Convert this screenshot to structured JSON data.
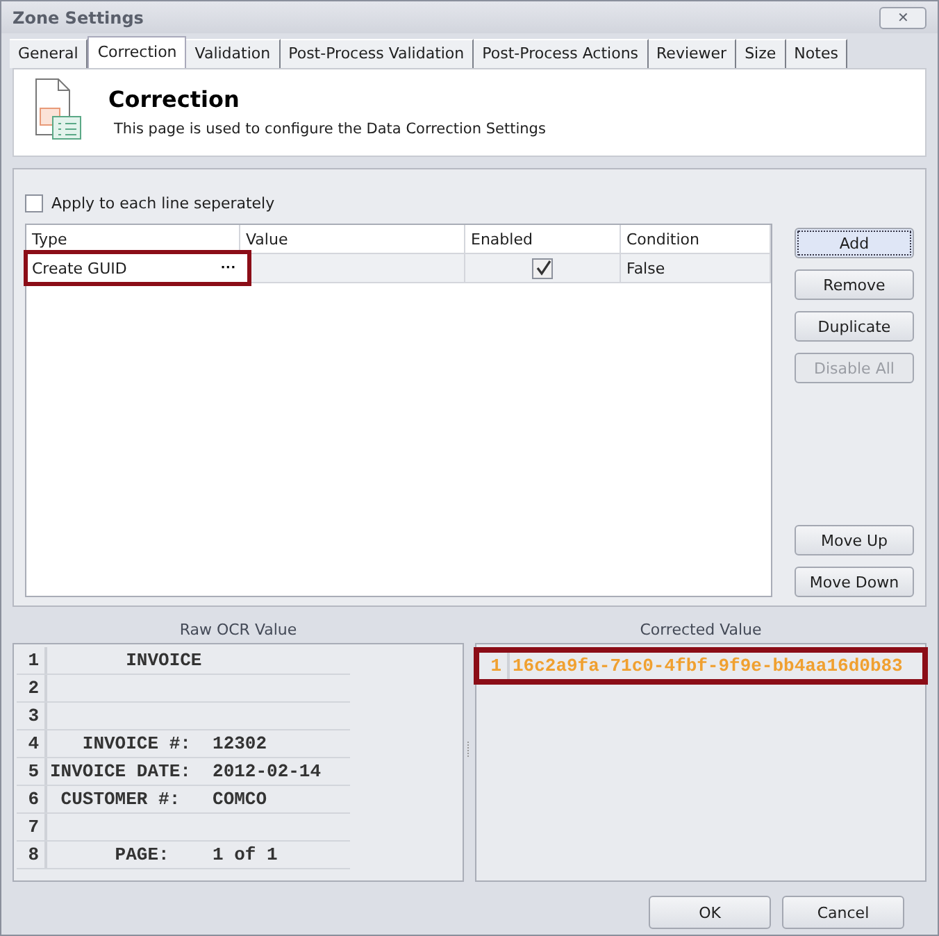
{
  "window": {
    "title": "Zone Settings",
    "close": "✕"
  },
  "tabs": [
    {
      "label": "General",
      "selected": false
    },
    {
      "label": "Correction",
      "selected": true
    },
    {
      "label": "Validation",
      "selected": false
    },
    {
      "label": "Post-Process Validation",
      "selected": false
    },
    {
      "label": "Post-Process Actions",
      "selected": false
    },
    {
      "label": "Reviewer",
      "selected": false
    },
    {
      "label": "Size",
      "selected": false
    },
    {
      "label": "Notes",
      "selected": false
    }
  ],
  "header": {
    "title": "Correction",
    "description": "This page is used to configure the Data Correction Settings"
  },
  "apply_each_line": {
    "label": "Apply to each line seperately",
    "checked": false
  },
  "table": {
    "columns": [
      "Type",
      "Value",
      "Enabled",
      "Condition"
    ],
    "rows": [
      {
        "type": "Create GUID",
        "ellipsis": "···",
        "enabled": true,
        "condition": "False",
        "highlighted": true
      }
    ]
  },
  "side_buttons": [
    {
      "label": "Add",
      "disabled": false,
      "focused": true
    },
    {
      "label": "Remove",
      "disabled": false,
      "focused": false
    },
    {
      "label": "Duplicate",
      "disabled": false,
      "focused": false
    },
    {
      "label": "Disable All",
      "disabled": true,
      "focused": false
    }
  ],
  "move_buttons": [
    "Move Up",
    "Move Down"
  ],
  "raw_ocr": {
    "title": "Raw OCR Value",
    "lines": [
      {
        "number": "1",
        "text": "       INVOICE"
      },
      {
        "number": "2"
      },
      {
        "number": "3"
      },
      {
        "number": "4",
        "text": "   INVOICE #:  12302"
      },
      {
        "number": "5",
        "text": "INVOICE DATE:  2012-02-14"
      },
      {
        "number": "6",
        "text": " CUSTOMER #:   COMCO"
      },
      {
        "number": "7"
      },
      {
        "number": "8",
        "text": "      PAGE:    1 of 1"
      }
    ]
  },
  "corrected": {
    "title": "Corrected Value",
    "highlighted": true,
    "lines": [
      {
        "number": "1",
        "text": "16c2a9fa-71c0-4fbf-9f9e-bb4aa16d0b83"
      }
    ]
  },
  "footer_buttons": [
    "OK",
    "Cancel"
  ]
}
